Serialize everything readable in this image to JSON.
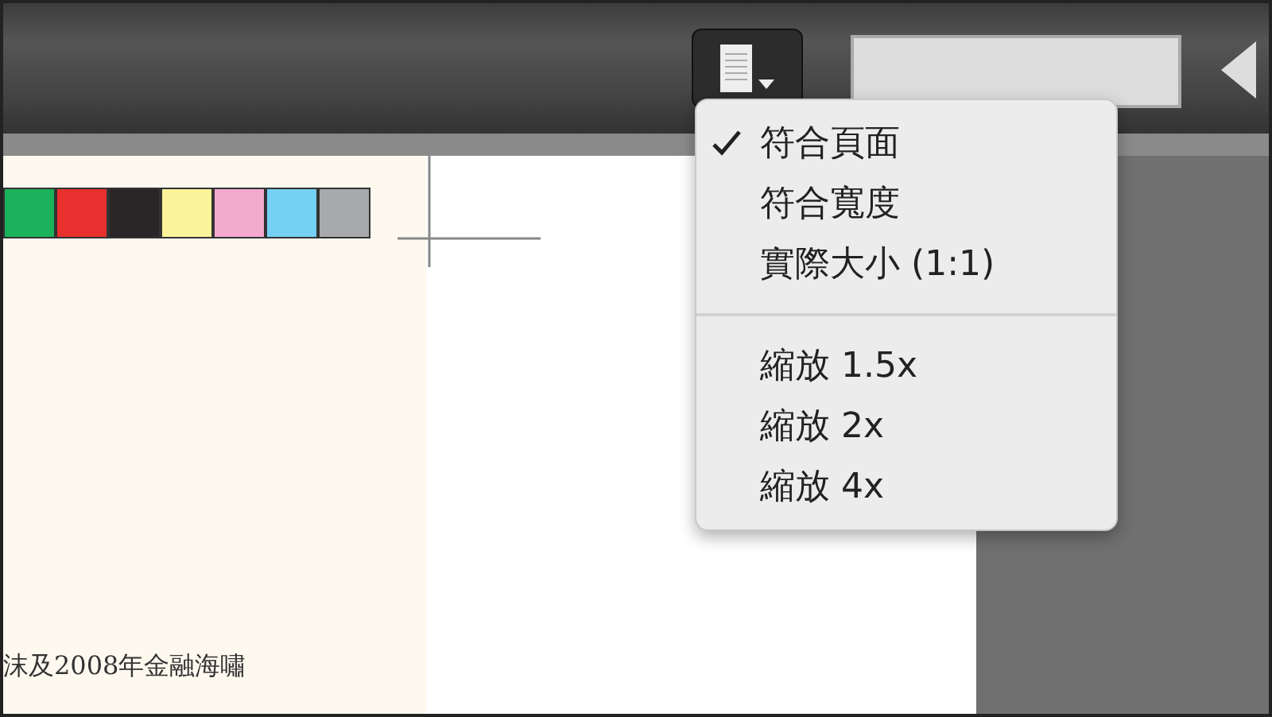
{
  "view_menu": {
    "groups": [
      [
        {
          "label": "符合頁面",
          "checked": true
        },
        {
          "label": "符合寬度",
          "checked": false
        },
        {
          "label": "實際大小 (1:1)",
          "checked": false
        }
      ],
      [
        {
          "label": "縮放 1.5x",
          "checked": false
        },
        {
          "label": "縮放 2x",
          "checked": false
        },
        {
          "label": "縮放 4x",
          "checked": false
        }
      ]
    ]
  },
  "swatches": [
    {
      "color": "#1ab25a"
    },
    {
      "color": "#e8302e"
    },
    {
      "color": "#2a2527"
    },
    {
      "color": "#fbf39a"
    },
    {
      "color": "#f4a9cf"
    },
    {
      "color": "#74d1f3"
    },
    {
      "color": "#a7a9ac"
    }
  ],
  "document_text": "沫及2008年金融海嘯"
}
